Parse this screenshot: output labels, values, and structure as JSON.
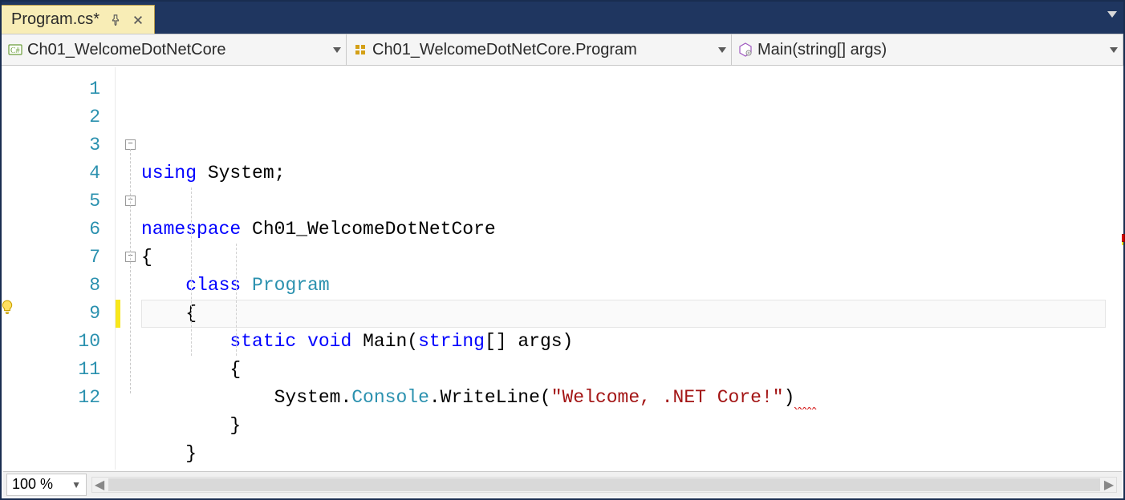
{
  "tab": {
    "label": "Program.cs*"
  },
  "nav": {
    "project": "Ch01_WelcomeDotNetCore",
    "type": "Ch01_WelcomeDotNetCore.Program",
    "member": "Main(string[] args)"
  },
  "zoom": "100 %",
  "code": {
    "lines": [
      {
        "n": 1,
        "indent": 0,
        "tokens": [
          [
            "kw",
            "using"
          ],
          [
            "",
            " "
          ],
          [
            "",
            "System"
          ],
          [
            "",
            ";"
          ]
        ]
      },
      {
        "n": 2,
        "indent": 0,
        "tokens": []
      },
      {
        "n": 3,
        "indent": 0,
        "tokens": [
          [
            "kw",
            "namespace"
          ],
          [
            "",
            " "
          ],
          [
            "",
            "Ch01_WelcomeDotNetCore"
          ]
        ],
        "fold": true
      },
      {
        "n": 4,
        "indent": 0,
        "tokens": [
          [
            "",
            "{"
          ]
        ]
      },
      {
        "n": 5,
        "indent": 1,
        "tokens": [
          [
            "kw",
            "class"
          ],
          [
            "",
            " "
          ],
          [
            "cls",
            "Program"
          ]
        ],
        "fold": true
      },
      {
        "n": 6,
        "indent": 1,
        "tokens": [
          [
            "",
            "{"
          ]
        ]
      },
      {
        "n": 7,
        "indent": 2,
        "tokens": [
          [
            "kw",
            "static"
          ],
          [
            "",
            " "
          ],
          [
            "kw",
            "void"
          ],
          [
            "",
            " "
          ],
          [
            "",
            "Main("
          ],
          [
            "kw",
            "string"
          ],
          [
            "",
            "[] args)"
          ]
        ],
        "fold": true
      },
      {
        "n": 8,
        "indent": 2,
        "tokens": [
          [
            "",
            "{"
          ]
        ]
      },
      {
        "n": 9,
        "indent": 3,
        "tokens": [
          [
            "",
            "System."
          ],
          [
            "cls",
            "Console"
          ],
          [
            "",
            ".WriteLine("
          ],
          [
            "str",
            "\"Welcome, .NET Core!\""
          ],
          [
            "",
            ")"
          ]
        ],
        "current": true,
        "bulb": true,
        "error_tail": true,
        "modified": true
      },
      {
        "n": 10,
        "indent": 2,
        "tokens": [
          [
            "",
            "}"
          ]
        ]
      },
      {
        "n": 11,
        "indent": 1,
        "tokens": [
          [
            "",
            "}"
          ]
        ]
      },
      {
        "n": 12,
        "indent": 0,
        "tokens": [
          [
            "",
            "}"
          ]
        ]
      }
    ]
  }
}
